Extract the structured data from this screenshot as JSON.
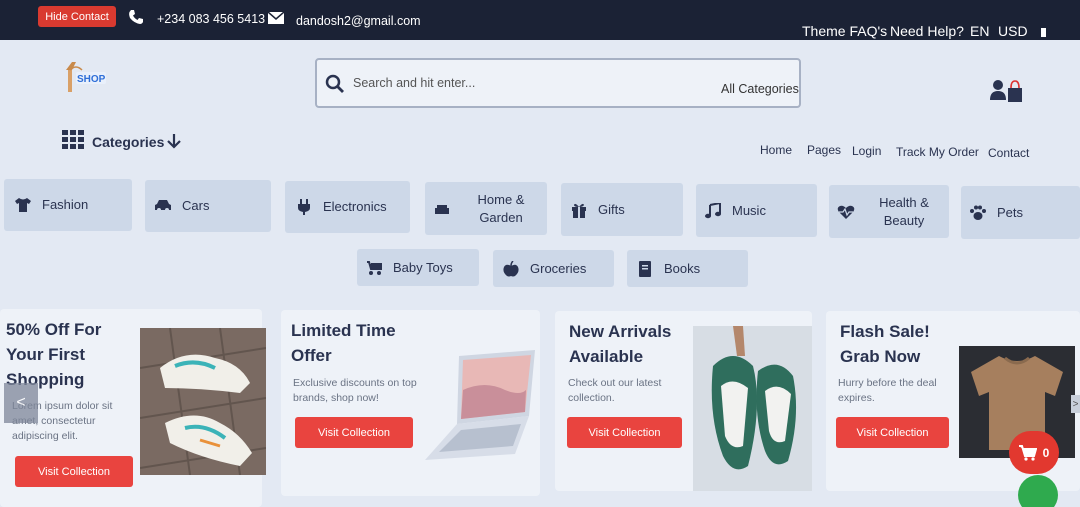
{
  "topbar": {
    "hide_contact": "Hide Contact",
    "phone": "+234 083 456 5413",
    "email": "dandosh2@gmail.com",
    "nav": [
      "Theme FAQ's",
      "Need Help?",
      "EN",
      "USD"
    ],
    "bg_color": "#1b2235"
  },
  "header": {
    "logo_text": "SHOP",
    "search_placeholder": "Search and hit enter...",
    "search_category": "All Categories"
  },
  "nav": {
    "categories_label": "Categories",
    "links": [
      "Home",
      "Pages",
      "Login",
      "Track My Order",
      "Contact"
    ]
  },
  "categories": [
    {
      "label": "Fashion",
      "icon": "tshirt-icon"
    },
    {
      "label": "Cars",
      "icon": "car-icon"
    },
    {
      "label": "Electronics",
      "icon": "plug-icon"
    },
    {
      "label": "Home & Garden",
      "icon": "couch-icon"
    },
    {
      "label": "Gifts",
      "icon": "gift-icon"
    },
    {
      "label": "Music",
      "icon": "music-icon"
    },
    {
      "label": "Health & Beauty",
      "icon": "heartbeat-icon"
    },
    {
      "label": "Pets",
      "icon": "paw-icon"
    },
    {
      "label": "Baby Toys",
      "icon": "baby-carriage-icon"
    },
    {
      "label": "Groceries",
      "icon": "apple-icon"
    },
    {
      "label": "Books",
      "icon": "book-icon"
    }
  ],
  "promos": [
    {
      "title": "50% Off For Your First Shopping",
      "desc": "Lorem ipsum dolor sit amet, consectetur adipiscing elit.",
      "button": "Visit Collection",
      "image": "sneakers"
    },
    {
      "title": "Limited Time Offer",
      "desc": "Exclusive discounts on top brands, shop now!",
      "button": "Visit Collection",
      "image": "laptop"
    },
    {
      "title": "New Arrivals Available",
      "desc": "Check out our latest collection.",
      "button": "Visit Collection",
      "image": "green-sneakers"
    },
    {
      "title": "Flash Sale! Grab Now",
      "desc": "Hurry before the deal expires.",
      "button": "Visit Collection",
      "image": "tshirt"
    }
  ],
  "cart": {
    "count": "0"
  },
  "slider": {
    "prev": "<",
    "next": ">"
  },
  "colors": {
    "accent": "#e9443f",
    "tile_bg": "#cdd8e8",
    "text": "#2a3350"
  }
}
